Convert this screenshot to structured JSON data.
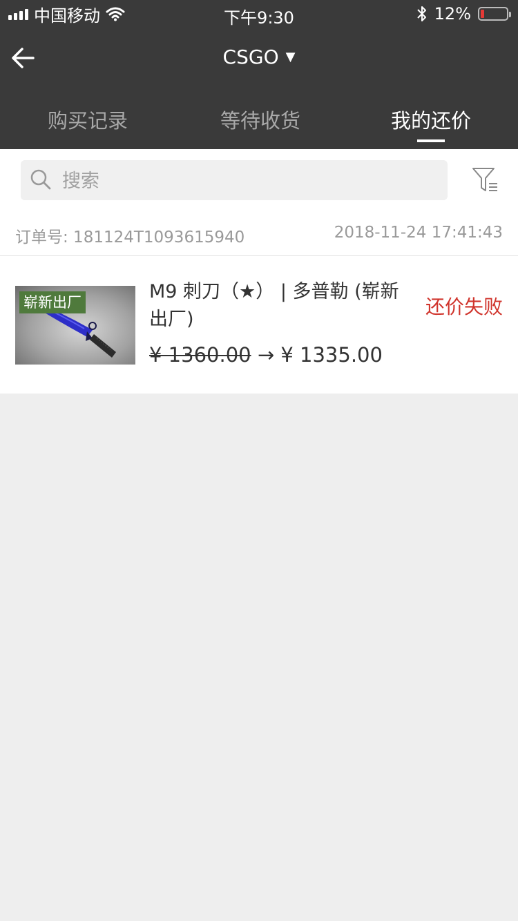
{
  "status_bar": {
    "carrier": "中国移动",
    "time": "下午9:30",
    "battery": "12%",
    "battery_level": 0.12
  },
  "nav": {
    "title": "CSGO"
  },
  "tabs": [
    {
      "label": "购买记录",
      "active": false
    },
    {
      "label": "等待收货",
      "active": false
    },
    {
      "label": "我的还价",
      "active": true
    }
  ],
  "search": {
    "placeholder": "搜索"
  },
  "order": {
    "number": "订单号: 181124T1093615940",
    "time": "2018-11-24 17:41:43",
    "item": {
      "badge": "崭新出厂",
      "name": "M9 刺刀（★） | 多普勒 (崭新出厂)",
      "price_original": "¥ 1360.00",
      "arrow": "→",
      "price_offer": "¥ 1335.00",
      "status": "还价失败"
    }
  },
  "colors": {
    "header_bg": "#3a3a3a",
    "status_fail": "#d0342c",
    "badge_bg": "#4f7a3c"
  }
}
